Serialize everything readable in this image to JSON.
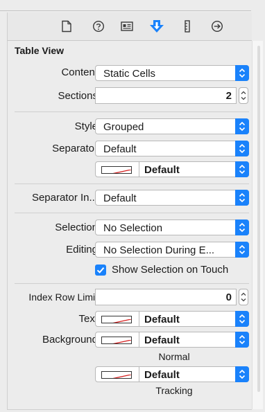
{
  "tabs": [
    {
      "name": "file-inspector-icon"
    },
    {
      "name": "quick-help-icon"
    },
    {
      "name": "identity-inspector-icon"
    },
    {
      "name": "attributes-inspector-icon"
    },
    {
      "name": "size-inspector-icon"
    },
    {
      "name": "connections-inspector-icon"
    }
  ],
  "accent_color": "#1a82fb",
  "section_title": "Table View",
  "content": {
    "label": "Content",
    "value": "Static Cells"
  },
  "sections": {
    "label": "Sections",
    "value": "2"
  },
  "style": {
    "label": "Style",
    "value": "Grouped"
  },
  "separator": {
    "label": "Separator",
    "value": "Default",
    "color_value": "Default"
  },
  "separator_inset": {
    "label": "Separator In...",
    "value": "Default"
  },
  "selection": {
    "label": "Selection",
    "value": "No Selection"
  },
  "editing": {
    "label": "Editing",
    "value": "No Selection During E..."
  },
  "show_selection": {
    "label": "Show Selection on Touch",
    "checked": true
  },
  "index_row_limit": {
    "label": "Index Row Limit",
    "value": "0"
  },
  "text_color": {
    "label": "Text",
    "value": "Default"
  },
  "background": {
    "label": "Background",
    "value": "Default",
    "caption": "Normal"
  },
  "tracking": {
    "value": "Default",
    "caption": "Tracking"
  }
}
